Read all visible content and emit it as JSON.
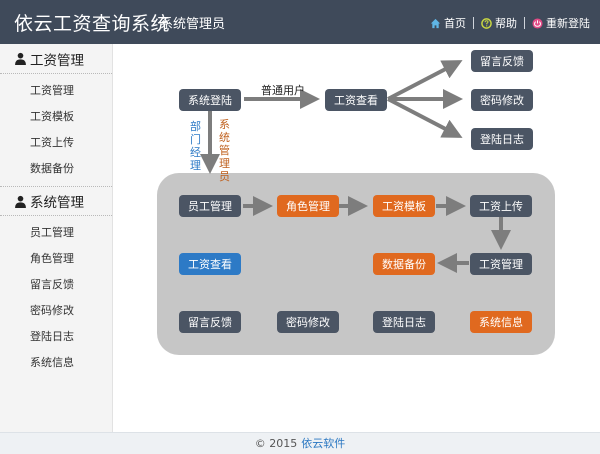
{
  "header": {
    "app_title": "依云工资查询系统",
    "role": "系统管理员",
    "links": {
      "home": "首页",
      "help": "帮助",
      "relogin": "重新登陆"
    },
    "colors": {
      "background": "#3f4a5a",
      "home_icon": "#5fb6e6",
      "help_icon": "#c8d642",
      "relogin_icon": "#e24a86"
    }
  },
  "sidebar": {
    "groups": [
      {
        "title": "工资管理",
        "items": [
          "工资管理",
          "工资模板",
          "工资上传",
          "数据备份"
        ]
      },
      {
        "title": "系统管理",
        "items": [
          "员工管理",
          "角色管理",
          "留言反馈",
          "密码修改",
          "登陆日志",
          "系统信息"
        ]
      }
    ]
  },
  "diagram": {
    "nodes": {
      "login": "系统登陆",
      "salary_view_top": "工资查看",
      "feedback_top": "留言反馈",
      "password_top": "密码修改",
      "log_top": "登陆日志",
      "employee_mgmt": "员工管理",
      "role_mgmt": "角色管理",
      "salary_template": "工资模板",
      "salary_upload": "工资上传",
      "salary_view": "工资查看",
      "data_backup": "数据备份",
      "salary_mgmt": "工资管理",
      "feedback": "留言反馈",
      "password": "密码修改",
      "login_log": "登陆日志",
      "system_info": "系统信息"
    },
    "labels": {
      "normal_user": "普通用户",
      "dept_manager": "部门经理",
      "sys_admin": "系统管理员"
    },
    "colors": {
      "dark": "#4b5564",
      "orange": "#e0691f",
      "blue": "#2d7ac6",
      "panel": "#c6c6c6",
      "arrow": "#7d7d7d"
    }
  },
  "footer": {
    "copyright": "© 2015",
    "brand": "依云软件"
  }
}
